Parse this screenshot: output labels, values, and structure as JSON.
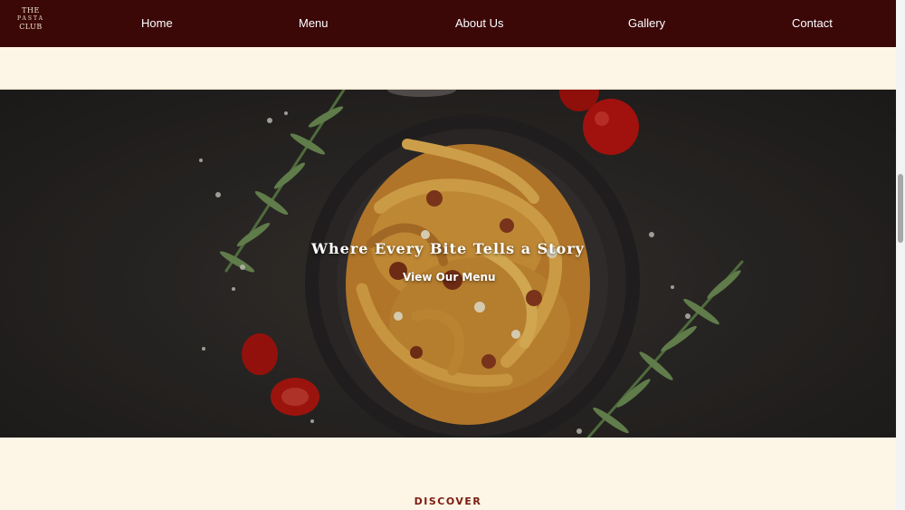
{
  "logo": {
    "line1": "THE",
    "line2": "PASTA",
    "line3": "CLUB"
  },
  "nav": {
    "items": [
      {
        "label": "Home"
      },
      {
        "label": "Menu"
      },
      {
        "label": "About Us"
      },
      {
        "label": "Gallery"
      },
      {
        "label": "Contact"
      }
    ]
  },
  "hero": {
    "title": "Where Every Bite Tells a Story",
    "cta_label": "View Our Menu"
  },
  "section": {
    "eyebrow": "DISCOVER"
  },
  "colors": {
    "nav_background": "#3b0707",
    "page_background": "#fdf5e6",
    "accent": "#7a1d12"
  }
}
